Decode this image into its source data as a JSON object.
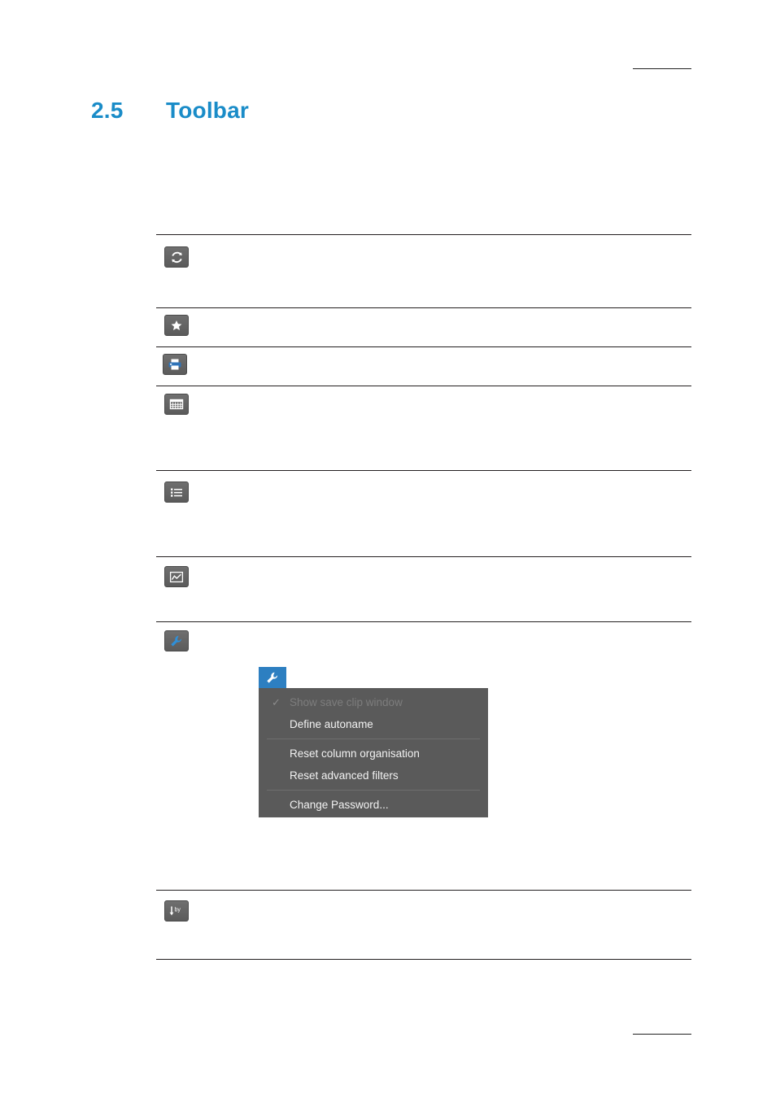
{
  "page": {
    "section_number": "2.5",
    "section_title": "Toolbar"
  },
  "toolbar_rows": [
    {
      "icon": "refresh-icon",
      "text": ""
    },
    {
      "icon": "star-icon",
      "text": ""
    },
    {
      "icon": "print-icon",
      "text": ""
    },
    {
      "icon": "grid-icon",
      "text": ""
    },
    {
      "icon": "list-icon",
      "text": ""
    },
    {
      "icon": "chart-icon",
      "text": ""
    },
    {
      "icon": "wrench-icon",
      "text": ""
    },
    {
      "icon": "sort-by-icon",
      "text": ""
    }
  ],
  "context_menu": {
    "button_icon": "wrench-icon",
    "items": [
      {
        "label": "Show save clip window",
        "disabled": true,
        "checked": true
      },
      {
        "label": "Define autoname",
        "disabled": false,
        "checked": false
      },
      {
        "label": "Reset column organisation",
        "disabled": false,
        "checked": false
      },
      {
        "label": "Reset advanced filters",
        "disabled": false,
        "checked": false
      },
      {
        "label": "Change Password...",
        "disabled": false,
        "checked": false
      }
    ],
    "separators_after": [
      1,
      3
    ],
    "colors": {
      "menu_background": "#5a5a5a",
      "button_background": "#2d7fc1",
      "disabled_text": "#7d7d7d",
      "text": "#f2f2f2"
    }
  },
  "colors": {
    "heading": "#1a8cc8",
    "rule": "#231f20",
    "chip_top": "#6f6f6f",
    "chip_bottom": "#5b5b5b"
  }
}
